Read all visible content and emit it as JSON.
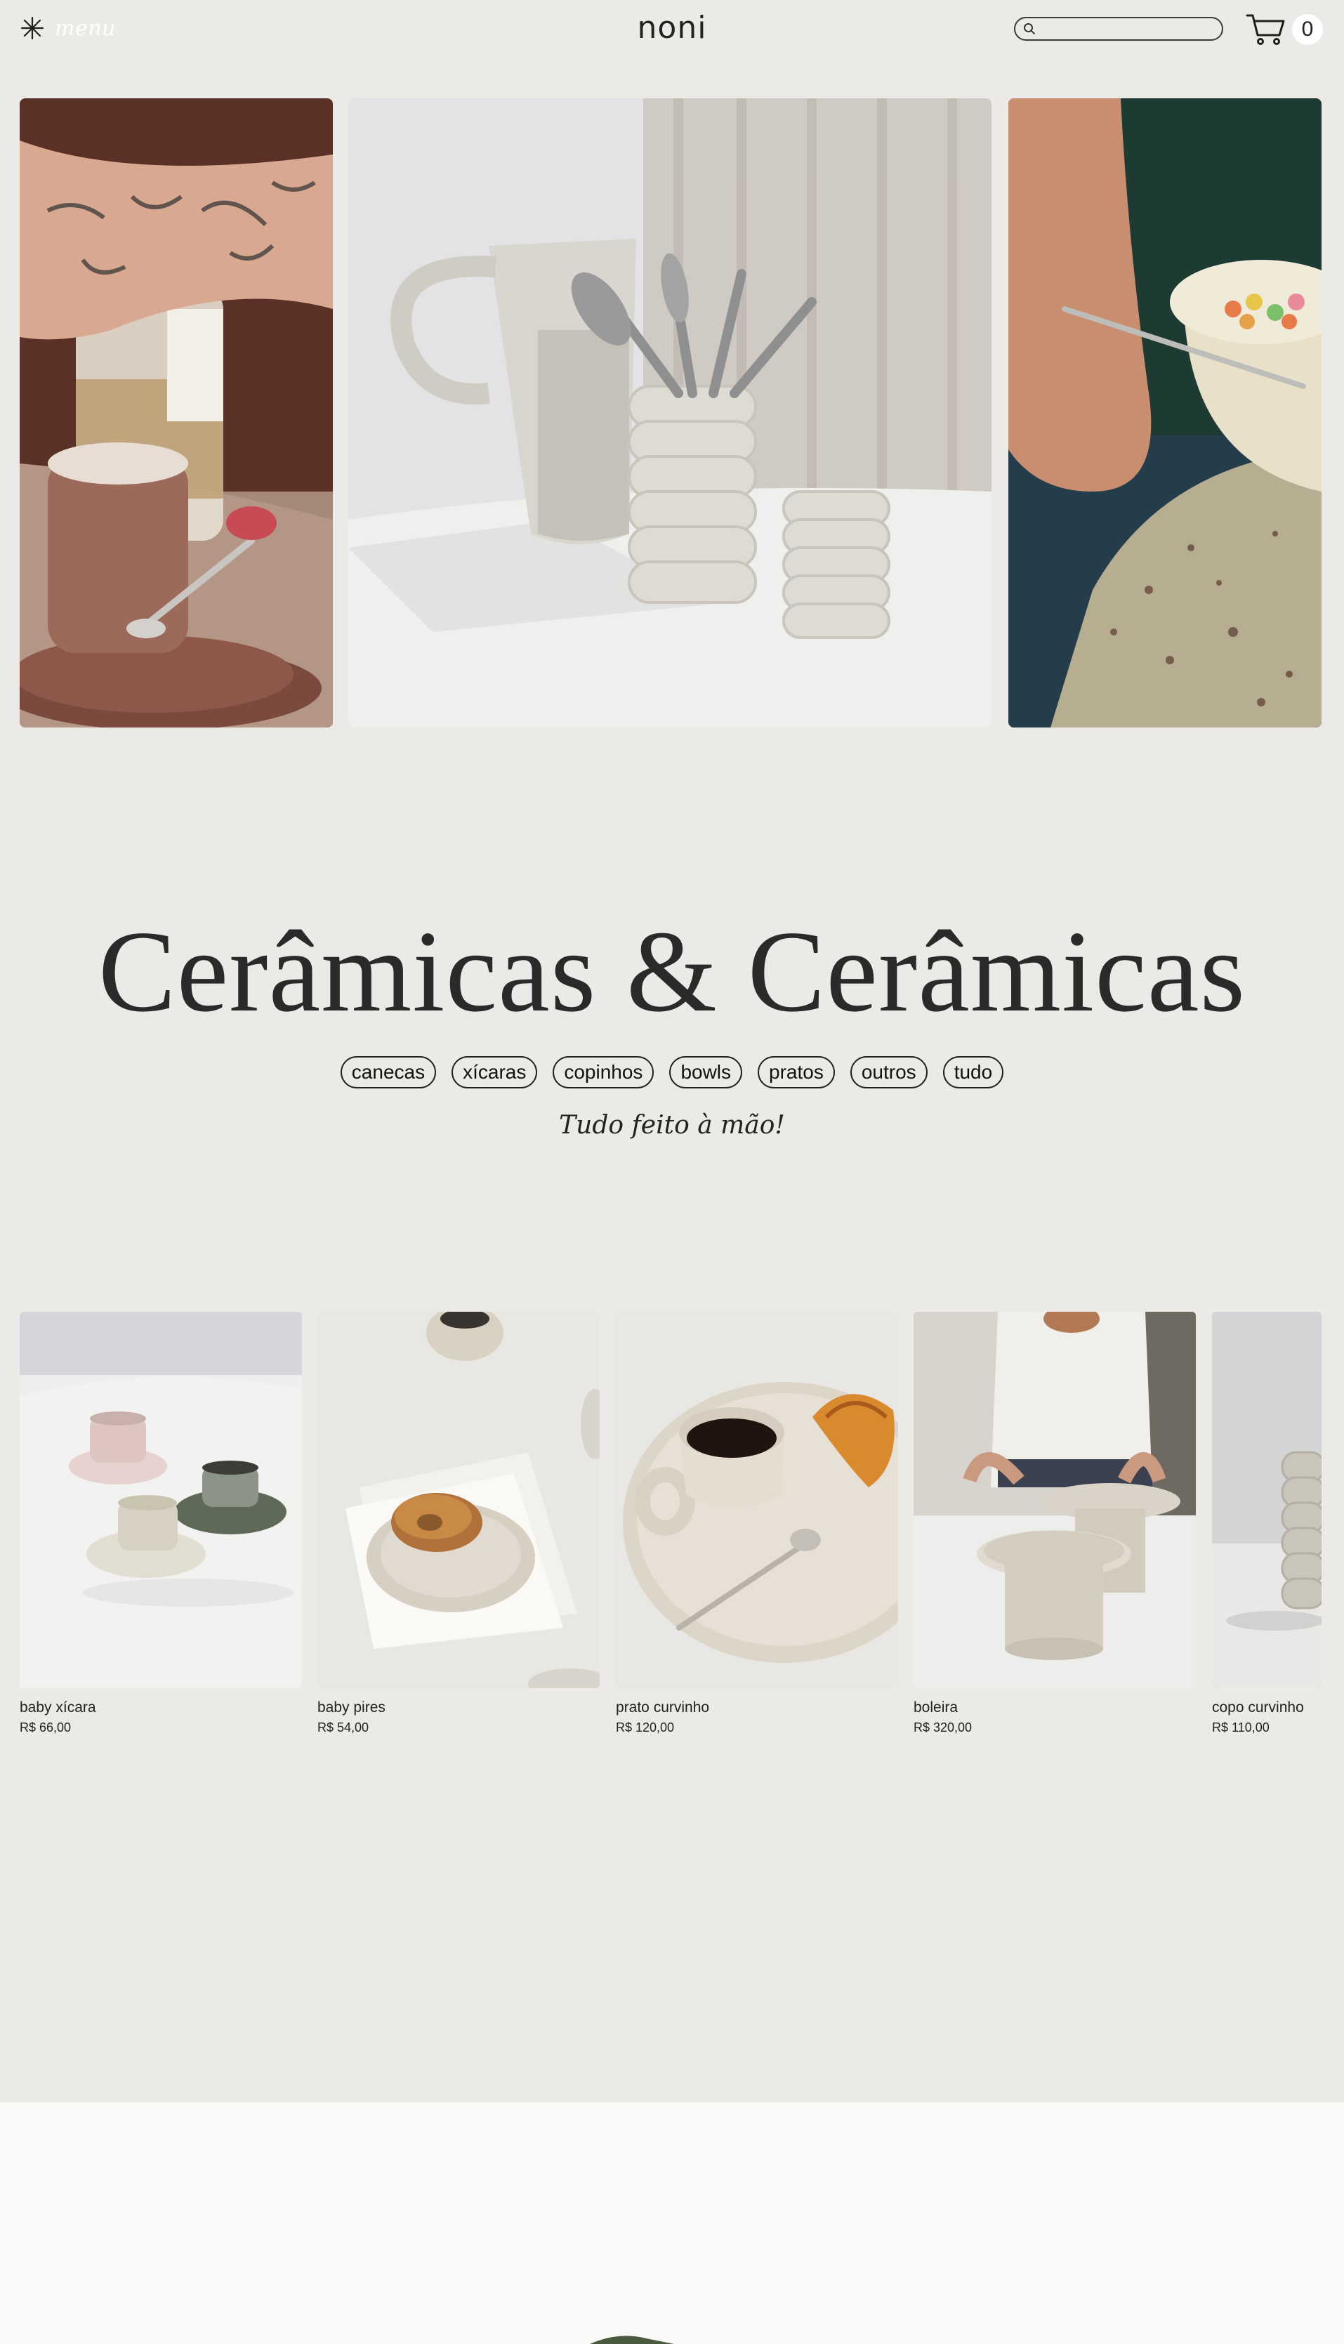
{
  "header": {
    "menu_label": "menu",
    "brand": "noni",
    "search_placeholder": "",
    "cart_count": "0"
  },
  "hero": {
    "images": [
      {
        "icon": "mug-with-tattooed-hand"
      },
      {
        "icon": "pitcher-and-cups"
      },
      {
        "icon": "cereal-bowl"
      }
    ]
  },
  "collection": {
    "title": "Cerâmicas & Cerâmicas",
    "categories": [
      "canecas",
      "xícaras",
      "copinhos",
      "bowls",
      "pratos",
      "outros",
      "tudo"
    ],
    "tagline": "Tudo feito à mão!"
  },
  "products": [
    {
      "name": "baby xícara",
      "price": "R$ 66,00"
    },
    {
      "name": "baby pires",
      "price": "R$ 54,00"
    },
    {
      "name": "prato curvinho",
      "price": "R$ 120,00"
    },
    {
      "name": "boleira",
      "price": "R$ 320,00"
    },
    {
      "name": "copo curvinho",
      "price": "R$ 110,00"
    }
  ],
  "colors": {
    "background": "#ebeae6",
    "lower_background": "#fafaf9",
    "text": "#222222"
  }
}
